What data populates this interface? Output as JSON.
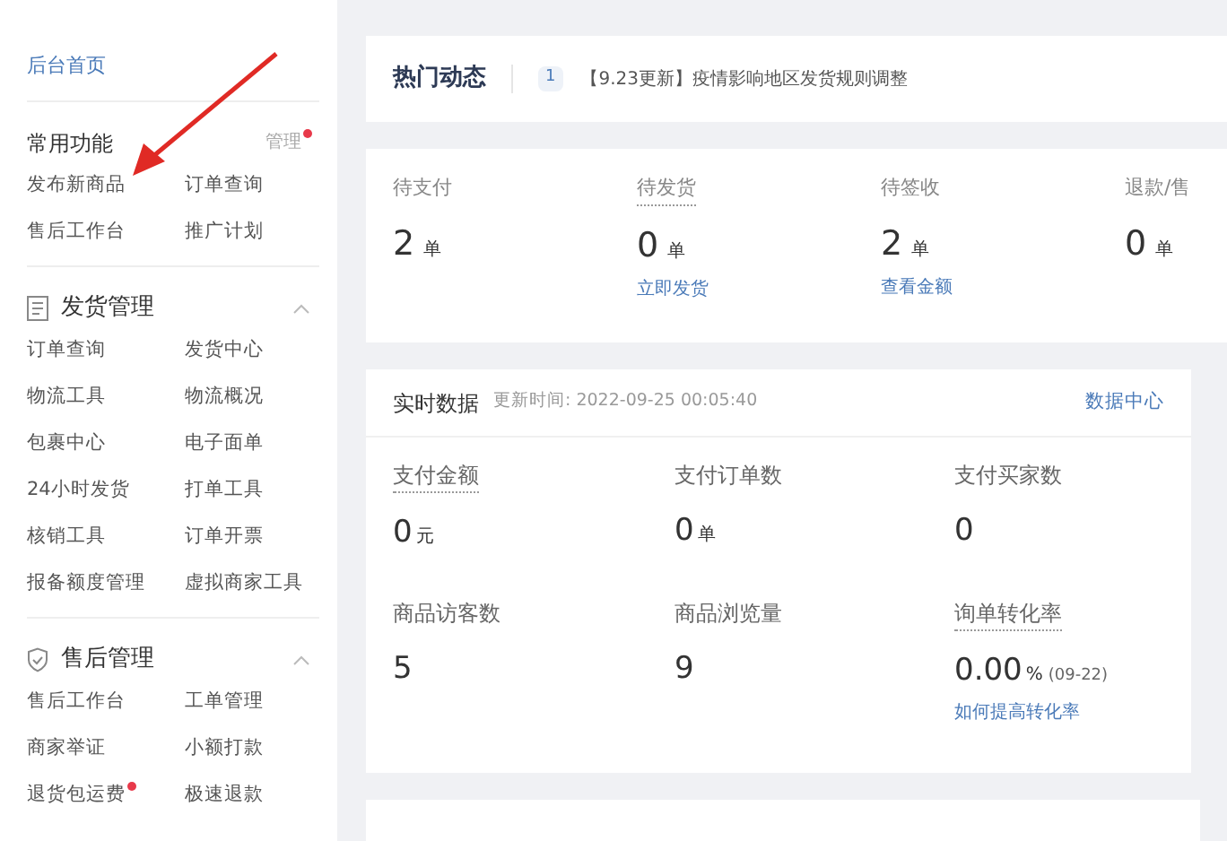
{
  "sidebar": {
    "home_link": "后台首页",
    "sections": [
      {
        "kind": "plain",
        "title": "常用功能",
        "manage": {
          "label": "管理",
          "dot": true
        },
        "items": [
          {
            "label": "发布新商品",
            "dot": false
          },
          {
            "label": "订单查询",
            "dot": false
          },
          {
            "label": "售后工作台",
            "dot": false
          },
          {
            "label": "推广计划",
            "dot": false
          }
        ]
      },
      {
        "kind": "doc",
        "title": "发货管理",
        "expanded": true,
        "items": [
          {
            "label": "订单查询",
            "dot": false
          },
          {
            "label": "发货中心",
            "dot": false
          },
          {
            "label": "物流工具",
            "dot": false
          },
          {
            "label": "物流概况",
            "dot": false
          },
          {
            "label": "包裹中心",
            "dot": false
          },
          {
            "label": "电子面单",
            "dot": false
          },
          {
            "label": "24小时发货",
            "dot": false
          },
          {
            "label": "打单工具",
            "dot": false
          },
          {
            "label": "核销工具",
            "dot": false
          },
          {
            "label": "订单开票",
            "dot": false
          },
          {
            "label": "报备额度管理",
            "dot": false
          },
          {
            "label": "虚拟商家工具",
            "dot": false
          }
        ]
      },
      {
        "kind": "shield",
        "title": "售后管理",
        "expanded": true,
        "items": [
          {
            "label": "售后工作台",
            "dot": false
          },
          {
            "label": "工单管理",
            "dot": false
          },
          {
            "label": "商家举证",
            "dot": false
          },
          {
            "label": "小额打款",
            "dot": false
          },
          {
            "label": "退货包运费",
            "dot": true
          },
          {
            "label": "极速退款",
            "dot": false
          }
        ]
      }
    ]
  },
  "news": {
    "title": "热门动态",
    "index": "1",
    "text": "【9.23更新】疫情影响地区发货规则调整"
  },
  "orders": [
    {
      "label": "待支付",
      "dotted": false,
      "value": "2",
      "unit": "单"
    },
    {
      "label": "待发货",
      "dotted": true,
      "value": "0",
      "unit": "单",
      "link": "立即发货"
    },
    {
      "label": "待签收",
      "dotted": false,
      "value": "2",
      "unit": "单",
      "link": "查看金额"
    },
    {
      "label": "退款/售",
      "dotted": false,
      "value": "0",
      "unit": "单"
    }
  ],
  "realtime": {
    "title": "实时数据",
    "updated": "更新时间: 2022-09-25 00:05:40",
    "link": "数据中心",
    "metrics": [
      {
        "label": "支付金额",
        "dotted": true,
        "value": "0",
        "unit": "元"
      },
      {
        "label": "支付订单数",
        "dotted": false,
        "value": "0",
        "unit": "单"
      },
      {
        "label": "支付买家数",
        "dotted": false,
        "value": "0"
      },
      {
        "label": "商品访客数",
        "dotted": false,
        "value": "5"
      },
      {
        "label": "商品浏览量",
        "dotted": false,
        "value": "9"
      },
      {
        "label": "询单转化率",
        "dotted": true,
        "value": "0.00",
        "unit": "%",
        "note": "(09-22)",
        "link": "如何提高转化率"
      }
    ]
  }
}
